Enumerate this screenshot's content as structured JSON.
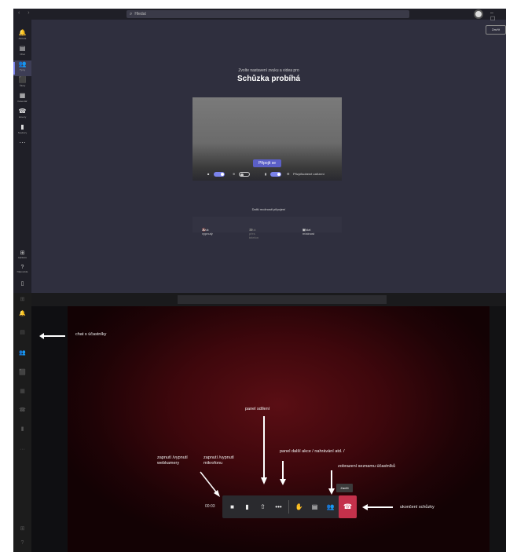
{
  "top": {
    "titlebar": {
      "nav": "‹  ›",
      "search_placeholder": "Hledat",
      "window_controls": "–  ☐",
      "close_button": "Zavřít"
    },
    "rail": {
      "items": [
        {
          "icon": "bell-icon",
          "glyph": "🔔",
          "label": "Aktivita"
        },
        {
          "icon": "chat-icon",
          "glyph": "▤",
          "label": "Chat"
        },
        {
          "icon": "teams-icon",
          "glyph": "👥",
          "label": "Týmy"
        },
        {
          "icon": "assignments-icon",
          "glyph": "⬛",
          "label": "Úkoly"
        },
        {
          "icon": "calendar-icon",
          "glyph": "▦",
          "label": "Kalendář"
        },
        {
          "icon": "calls-icon",
          "glyph": "☎",
          "label": "Hovory"
        },
        {
          "icon": "files-icon",
          "glyph": "▮",
          "label": "Soubory"
        },
        {
          "icon": "more-icon",
          "glyph": "···",
          "label": ""
        }
      ],
      "bottom": [
        {
          "icon": "apps-icon",
          "glyph": "⊞",
          "label": "Aplikace"
        },
        {
          "icon": "help-icon",
          "glyph": "?",
          "label": "Nápověda"
        },
        {
          "icon": "device-icon",
          "glyph": "▯",
          "label": ""
        }
      ]
    },
    "prejoin": {
      "subtitle": "Zvolte nastavení zvuku a videa pro",
      "title": "Schůzka probíhá",
      "join_button": "Připojit se",
      "camera_label": "",
      "blur_label": "",
      "mic_label": "",
      "device_settings": "Přizpůsobené zařízení",
      "more_options_title": "Další možnosti připojení",
      "option_audio_off": "Zvuk vypnutý",
      "option_phone": "Zvuk přes telefon",
      "option_room": "Přidat místnost"
    }
  },
  "bottom": {
    "annotations": {
      "chat": "chat s účastníky",
      "share_panel": "panel sdílení",
      "webcam": "zapnutí /vypnutí webkamery",
      "mic": "zapnutí /vypnutí mikrofonu",
      "more_actions": "panel další akce / nahrávání atd. /",
      "participants": "zobrazení seznamu účastníků",
      "end_meeting": "ukončení schůzky"
    },
    "meeting_bar": {
      "time": "00:03",
      "tooltip": "Zavřít"
    }
  }
}
